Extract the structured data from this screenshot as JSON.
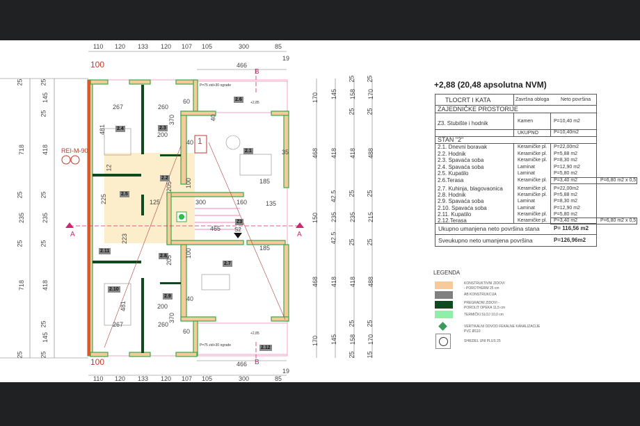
{
  "plan": {
    "top_dims": [
      "110",
      "120",
      "133",
      "120",
      "107",
      "105",
      "300",
      "85"
    ],
    "bottom_dims": [
      "110",
      "120",
      "133",
      "120",
      "107",
      "105",
      "300",
      "85"
    ],
    "dim_19": "19",
    "dim_466": "466",
    "dim_100": "100",
    "section_b": "B",
    "section_a": "A",
    "left_outer": [
      "25",
      "718",
      "25",
      "235",
      "25",
      "718",
      "25"
    ],
    "left_inner": [
      "25",
      "145",
      "25",
      "418",
      "25",
      "235",
      "25",
      "418",
      "25",
      "145",
      "25"
    ],
    "right_1": [
      "170",
      "468",
      "150",
      "468",
      "170"
    ],
    "right_2": [
      "145",
      "418",
      "42.5",
      "235",
      "42.5",
      "418",
      "145"
    ],
    "right_3": [
      "25",
      "158",
      "25",
      "418",
      "25",
      "235",
      "25",
      "418",
      "25",
      "158",
      "25"
    ],
    "right_4": [
      "25",
      "170",
      "25",
      "488",
      "25",
      "215",
      "25",
      "488",
      "25",
      "170",
      "15"
    ],
    "rooms": [
      "2.1",
      "2.2",
      "2.3",
      "2.4",
      "2.5",
      "2.6",
      "2.7",
      "2.8",
      "2.9",
      "2.10",
      "2.11",
      "2.12",
      "Z3"
    ],
    "fire_label": "REI-M-90",
    "stair_marker": "1",
    "s2": "S2",
    "inner_dims": [
      "267",
      "260",
      "481",
      "200",
      "370",
      "60",
      "40",
      "35",
      "185",
      "125",
      "300",
      "160",
      "135",
      "465",
      "100",
      "223",
      "12",
      "225",
      "40",
      "200",
      "370",
      "481",
      "267",
      "260",
      "60",
      "40",
      "100",
      "185",
      "205",
      "205"
    ],
    "terrace_note": "P=75 zid+30 ograde",
    "level": "+2,85"
  },
  "table": {
    "title": "+2,88 (20,48 apsolutna NVM)",
    "headers": [
      "TLOCRT I KATA",
      "Završna obloga",
      "Neto površina"
    ],
    "common_heading": "ZAJEDNIČKE PROSTORIJE",
    "common_row": {
      "name": "Z3. Stubište i hodnik",
      "finish": "Kamen",
      "area": "P=10,40 m2"
    },
    "common_total": {
      "label": "UKUPNO",
      "area": "P=10,40m2"
    },
    "unit_heading": "STAN \"2\"",
    "rows": [
      {
        "name": "2.1. Dnevni boravak",
        "finish": "Keramičke pl.",
        "area": "P=22,00m2"
      },
      {
        "name": "2.2. Hodnik",
        "finish": "Keramičke pl.",
        "area": "P=5,88 m2"
      },
      {
        "name": "2.3. Spavaća soba",
        "finish": "Keramičke pl.",
        "area": "P=8,30 m2"
      },
      {
        "name": "2.4. Spavaća soba",
        "finish": "Laminat",
        "area": "P=12,90 m2"
      },
      {
        "name": "2.5. Kupatilo",
        "finish": "Laminat",
        "area": "P=5,80 m2"
      },
      {
        "name": "2.6.Terasa",
        "finish": "Keramičke pl.",
        "area": "P=3,40 m2",
        "extra": "P=6,80 m2 x 0,5"
      },
      {
        "name": "2.7. Kuhinja, blagovaonica",
        "finish": "Keramičke pl.",
        "area": "P=22,00m2"
      },
      {
        "name": "2.8. Hodnik",
        "finish": "Keramičke pl.",
        "area": "P=5,88 m2"
      },
      {
        "name": "2.9. Spavaća soba",
        "finish": "Laminat",
        "area": "P=8,30 m2"
      },
      {
        "name": "2.10. Spavaća soba",
        "finish": "Laminat",
        "area": "P=12,90 m2"
      },
      {
        "name": "2.11. Kupatilo",
        "finish": "Keramičke pl.",
        "area": "P=5,80 m2"
      },
      {
        "name": "2.12.Terasa",
        "finish": "Keramičke pl.",
        "area": "P=3,40 m2",
        "extra": "P=6,80 m2 x 0,5"
      }
    ],
    "unit_total": {
      "label": "Ukupno umanjena neto površina stana",
      "area": "P= 116,56 m2"
    },
    "grand_total": {
      "label": "Sveukupno neto umanjena površina",
      "area": "P=126,96m2"
    }
  },
  "legend": {
    "title": "LEGENDA",
    "items": [
      {
        "label": "KONSTRUKTIVNI ZIDOVI - POROTHERM 25 cm",
        "color": "#f8c99a"
      },
      {
        "label": "AB KONSTRUKCIJA",
        "color": "#808080"
      },
      {
        "label": "PREGRADNI ZIDOVI -POROLIT OPEKA 11,5 cm",
        "color": "#0f4a1e"
      },
      {
        "label": "TERMIČKI SLOJ 10,0 cm",
        "color": "#8ef0a8"
      },
      {
        "label": "VERTIKALNI ODVOD FEKALNE KANALIZACIJE PVC Ø110"
      },
      {
        "label": "SHIEDEL UNI PLUS 25"
      }
    ]
  }
}
